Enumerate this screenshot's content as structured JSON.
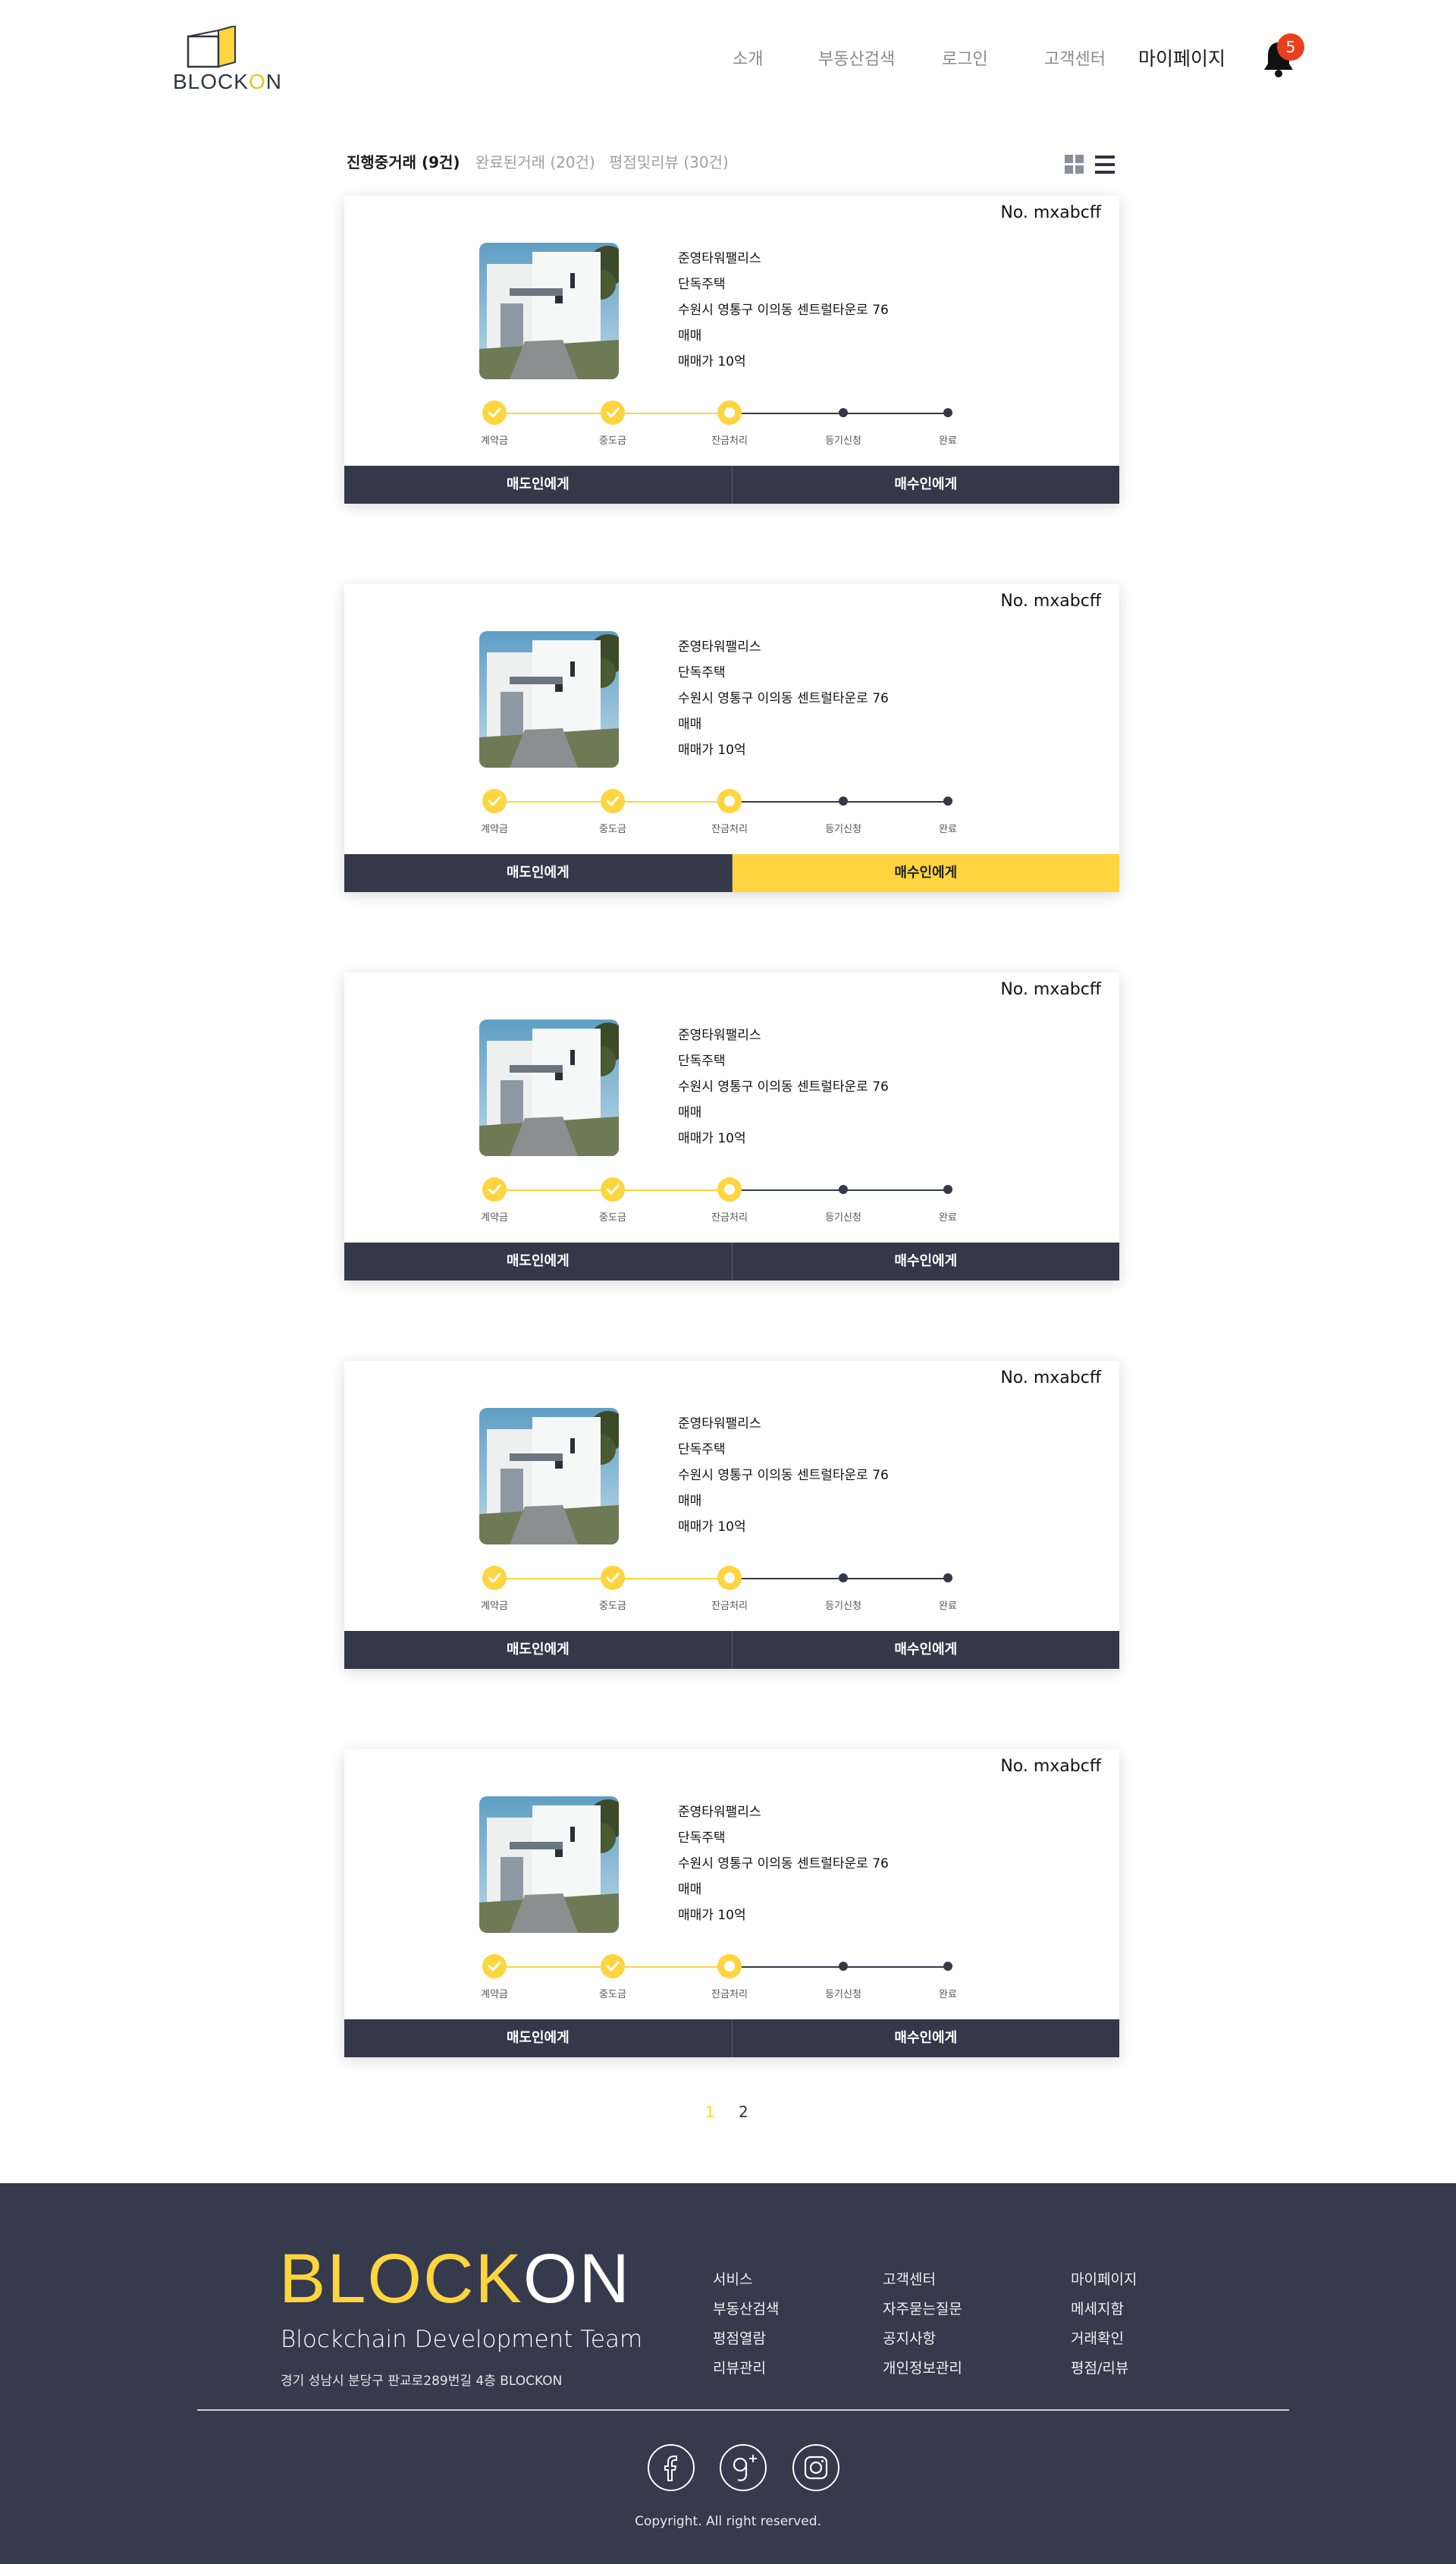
{
  "header": {
    "logo_prefix": "BLOCK",
    "logo_hl": "O",
    "logo_suffix": "N",
    "nav": [
      {
        "label": "소개"
      },
      {
        "label": "부동산검색"
      },
      {
        "label": "로그인"
      },
      {
        "label": "고객센터"
      },
      {
        "label": "마이페이지"
      }
    ],
    "notification_count": "5"
  },
  "tabs": [
    {
      "label": "진행중거래 (9건)"
    },
    {
      "label": "완료된거래 (20건)"
    },
    {
      "label": "평점및리뷰 (30건)"
    }
  ],
  "cards": [
    {
      "no": "No. mxabcff",
      "name": "준영타워팰리스",
      "type": "단독주택",
      "address": "수원시 영통구 이의동 센트럴타운로 76",
      "deal": "매매",
      "price": "매매가 10억",
      "seller_btn": "매도인에게",
      "buyer_btn": "매수인에게",
      "highlight": "none"
    },
    {
      "no": "No. mxabcff",
      "name": "준영타워팰리스",
      "type": "단독주택",
      "address": "수원시 영통구 이의동 센트럴타운로 76",
      "deal": "매매",
      "price": "매매가 10억",
      "seller_btn": "매도인에게",
      "buyer_btn": "매수인에게",
      "highlight": "buyer"
    },
    {
      "no": "No. mxabcff",
      "name": "준영타워팰리스",
      "type": "단독주택",
      "address": "수원시 영통구 이의동 센트럴타운로 76",
      "deal": "매매",
      "price": "매매가 10억",
      "seller_btn": "매도인에게",
      "buyer_btn": "매수인에게",
      "highlight": "none"
    },
    {
      "no": "No. mxabcff",
      "name": "준영타워팰리스",
      "type": "단독주택",
      "address": "수원시 영통구 이의동 센트럴타운로 76",
      "deal": "매매",
      "price": "매매가 10억",
      "seller_btn": "매도인에게",
      "buyer_btn": "매수인에게",
      "highlight": "none"
    },
    {
      "no": "No. mxabcff",
      "name": "준영타워팰리스",
      "type": "단독주택",
      "address": "수원시 영통구 이의동 센트럴타운로 76",
      "deal": "매매",
      "price": "매매가 10억",
      "seller_btn": "매도인에게",
      "buyer_btn": "매수인에게",
      "highlight": "none"
    }
  ],
  "steps": [
    {
      "label": "계약금",
      "state": "done"
    },
    {
      "label": "중도금",
      "state": "done"
    },
    {
      "label": "잔금처리",
      "state": "current"
    },
    {
      "label": "등기신청",
      "state": "pending"
    },
    {
      "label": "완료",
      "state": "pending"
    }
  ],
  "pagination": {
    "pages": [
      "1",
      "2"
    ],
    "current": "1"
  },
  "footer": {
    "brand_part1": "BLOCK",
    "brand_part2": "ON",
    "team": "Blockchain Development Team",
    "address": "경기 성남시 분당구 판교로289번길 4층 BLOCKON",
    "columns": [
      [
        "서비스",
        "부동산검색",
        "평점열람",
        "리뷰관리"
      ],
      [
        "고객센터",
        "자주묻는질문",
        "공지사항",
        "개인정보관리"
      ],
      [
        "마이페이지",
        "메세지함",
        "거래확인",
        "평점/리뷰"
      ]
    ],
    "social": [
      "facebook-icon",
      "google-plus-icon",
      "instagram-icon"
    ],
    "copyright": "Copyright. All right reserved."
  },
  "colors": {
    "accent": "#ffd53f",
    "dark": "#343849",
    "footer_bg": "#363a4d",
    "badge": "#e8401c"
  }
}
